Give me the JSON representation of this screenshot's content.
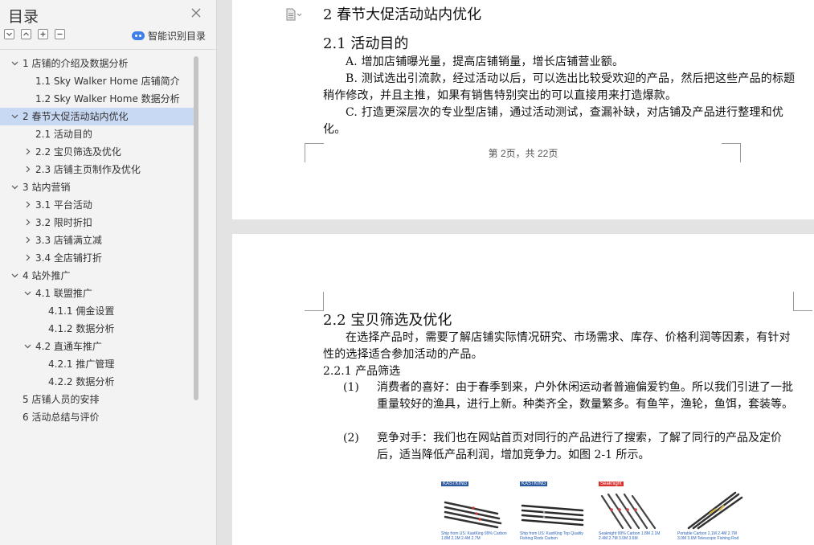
{
  "sidebar": {
    "title": "目录",
    "smart_label": "智能识别目录",
    "tools": [
      "expand-all-icon",
      "collapse-all-icon",
      "add-heading-icon",
      "remove-heading-icon"
    ],
    "items": [
      {
        "label": "1 店铺的介绍及数据分析",
        "expanded": true
      },
      {
        "label": "1.1 Sky Walker Home 店铺简介"
      },
      {
        "label": "1.2 Sky Walker Home 数据分析"
      },
      {
        "label": "2 春节大促活动站内优化",
        "expanded": true,
        "selected": true
      },
      {
        "label": "2.1 活动目的"
      },
      {
        "label": "2.2 宝贝筛选及优化",
        "expanded": false
      },
      {
        "label": "2.3 店铺主页制作及优化",
        "expanded": false
      },
      {
        "label": "3 站内营销",
        "expanded": true
      },
      {
        "label": "3.1 平台活动",
        "expanded": false
      },
      {
        "label": "3.2 限时折扣",
        "expanded": false
      },
      {
        "label": "3.3 店铺满立减",
        "expanded": false
      },
      {
        "label": "3.4 全店铺打折",
        "expanded": false
      },
      {
        "label": "4 站外推广",
        "expanded": true
      },
      {
        "label": "4.1 联盟推广",
        "expanded": true
      },
      {
        "label": "4.1.1 佣金设置"
      },
      {
        "label": "4.1.2 数据分析"
      },
      {
        "label": "4.2 直通车推广",
        "expanded": true
      },
      {
        "label": "4.2.1 推广管理"
      },
      {
        "label": "4.2.2 数据分析"
      },
      {
        "label": "5 店铺人员的安排"
      },
      {
        "label": "6 活动总结与评价"
      }
    ]
  },
  "page1": {
    "heading": "2 春节大促活动站内优化",
    "subheading": "2.1 活动目的",
    "para_a": "A. 增加店铺曝光量，提高店铺销量，增长店铺营业额。",
    "para_b": "B. 测试选出引流款，经过活动以后，可以选出比较受欢迎的产品，然后把这些产品的标题稍作修改，并且主推，如果有销售特别突出的可以直接用来打造爆款。",
    "para_c": "C. 打造更深层次的专业型店铺，通过活动测试，查漏补缺，对店铺及产品进行整理和优化。",
    "footer": "第 2页，共 22页"
  },
  "page2": {
    "heading": "2.2 宝贝筛选及优化",
    "intro": "在选择产品时，需要了解店铺实际情况研究、市场需求、库存、价格利润等因素，有针对性的选择适合参加活动的产品。",
    "sub": "2.2.1 产品筛选",
    "item1_num": "(1)",
    "item1": "消费者的喜好：由于春季到来，户外休闲运动者普遍偏爱钓鱼。所以我们引进了一批重量较好的渔具，进行上新。种类齐全，数量繁多。有鱼竿，渔轮，鱼饵，套装等。",
    "item2_num": "(2)",
    "item2": "竞争对手：我们也在网站首页对同行的产品进行了搜索，了解了同行的产品及定价后，适当降低产品利润，增加竞争力。如图 2-1 所示。",
    "products": [
      {
        "brand": "KASTKING",
        "caption": "Ship from US: KastKing 99% Carbon 1.8M 2.1M 2.4M 2.7M"
      },
      {
        "brand": "KASTKING",
        "caption": "Ship from US: KastKing Top Quality Fishing Rods Carbon"
      },
      {
        "brand": "Seaknight",
        "caption": "Seaknight 99% Carbon 1.8M 2.1M 2.4M 2.7M 3.0M 3.6M"
      },
      {
        "brand": "",
        "caption": "Portable Carbon 2.1M 2.4M 2.7M 3.0M 3.6M Telescopic Fishing Rod"
      }
    ]
  }
}
